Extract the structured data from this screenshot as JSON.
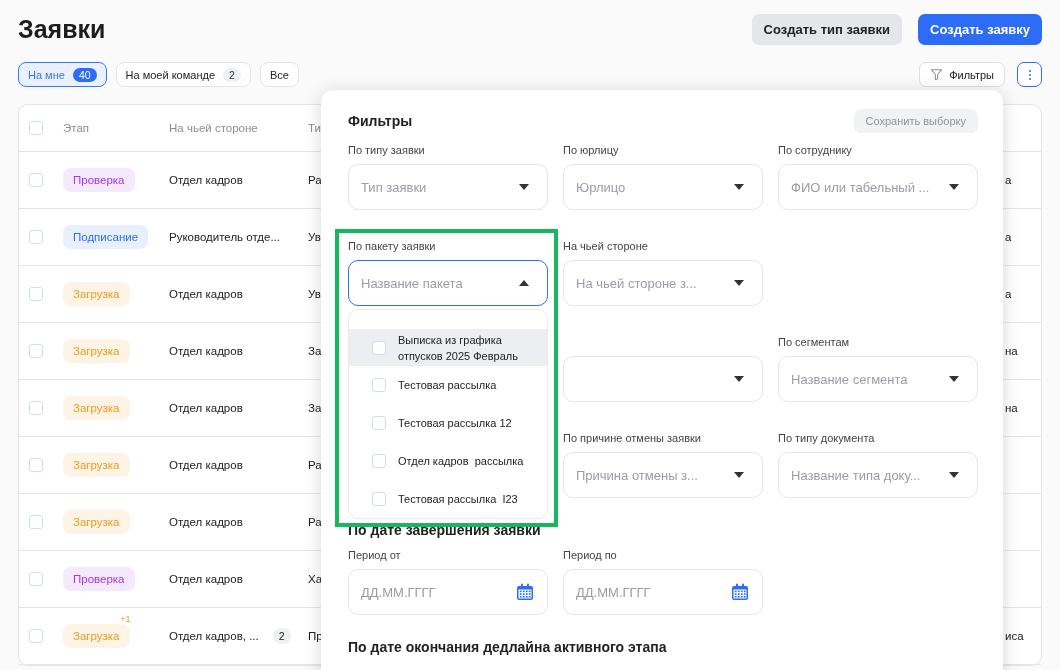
{
  "page": {
    "title": "Заявки"
  },
  "actions": [
    {
      "label": "Создать тип заявки",
      "kind": "secondary"
    },
    {
      "label": "Создать заявку",
      "kind": "primary"
    }
  ],
  "tabs": [
    {
      "label": "На мне",
      "count": "40",
      "selected": true
    },
    {
      "label": "На моей команде",
      "count": "2",
      "selected": false
    },
    {
      "label": "Все",
      "selected": false
    }
  ],
  "toolbar": {
    "filters_button": "Фильтры"
  },
  "table": {
    "columns": [
      "Этап",
      "На чьей стороне",
      "Ти"
    ],
    "header_checked": false,
    "rows": [
      {
        "checked": false,
        "stage": {
          "label": "Проверка",
          "color": "#a336f0"
        },
        "side": "Отдел кадров",
        "column_3": "Ра",
        "column_4": "а"
      },
      {
        "checked": false,
        "stage": {
          "label": "Подписание",
          "color": "#2d6cf5"
        },
        "side": "Руководитель отде...",
        "column_3": "Ув",
        "column_4": "а"
      },
      {
        "checked": false,
        "stage": {
          "label": "Загрузка",
          "color": "#f0991d"
        },
        "side": "Отдел кадров",
        "column_3": "Ув",
        "column_4": "а"
      },
      {
        "checked": false,
        "stage": {
          "label": "Загрузка",
          "color": "#f0991d"
        },
        "side": "Отдел кадров",
        "column_3": "За",
        "column_4": "на"
      },
      {
        "checked": false,
        "stage": {
          "label": "Загрузка",
          "color": "#f0991d"
        },
        "side": "Отдел кадров",
        "column_3": "За",
        "column_4": "на"
      },
      {
        "checked": false,
        "stage": {
          "label": "Загрузка",
          "color": "#f0991d"
        },
        "side": "Отдел кадров",
        "column_3": "Ра"
      },
      {
        "checked": false,
        "stage": {
          "label": "Загрузка",
          "color": "#f0991d"
        },
        "side": "Отдел кадров",
        "column_3": "Ра"
      },
      {
        "checked": false,
        "stage": {
          "label": "Проверка",
          "color": "#a336f0"
        },
        "side": "Отдел кадров",
        "column_3": "Ха"
      },
      {
        "checked": false,
        "stage": {
          "label": "Загрузка",
          "color": "#f0991d",
          "extra": "+1"
        },
        "side": "Отдел кадров, ...",
        "side_count": "2",
        "column_3": "Пр",
        "column_4": "иса"
      }
    ]
  },
  "filters_panel": {
    "title": "Фильтры",
    "save_button": "Сохранить выборку",
    "fields": [
      {
        "kind": "select",
        "label": "По типу заявки",
        "placeholder": "Тип заявки"
      },
      {
        "kind": "select",
        "label": "По юрлицу",
        "placeholder": "Юрлицо"
      },
      {
        "kind": "select",
        "label": "По сотруднику",
        "placeholder": "ФИО или табельный ..."
      },
      {
        "kind": "select",
        "label": "По пакету заявки",
        "placeholder": "Название пакета",
        "expanded": true,
        "highlighted": true,
        "options": [
          {
            "label": "Выписка из графика отпусков 2025 Февраль",
            "checked": false,
            "hovered": true
          },
          {
            "label": "Тестовая рассылка",
            "checked": false,
            "hovered": false
          },
          {
            "label": "Тестовая рассылка 12",
            "checked": false,
            "hovered": false
          },
          {
            "label": "Отдел кадров  рассылка",
            "checked": false,
            "hovered": false
          },
          {
            "label": "Тестовая рассылка  I23",
            "checked": false,
            "hovered": false
          }
        ]
      },
      {
        "kind": "select",
        "label": "На чьей стороне",
        "placeholder": "На чьей стороне з..."
      },
      {
        "kind": "blank"
      },
      {
        "kind": "blank"
      },
      {
        "kind": "select"
      },
      {
        "kind": "select",
        "label": "По сегментам",
        "placeholder": "Название сегмента"
      },
      {
        "kind": "blank"
      },
      {
        "kind": "select",
        "label": "По причине отмены заявки",
        "placeholder": "Причина отмены з..."
      },
      {
        "kind": "select",
        "label": "По типу документа",
        "placeholder": "Название типа доку..."
      }
    ],
    "sections": [
      {
        "title": "По дате завершения заявки",
        "fields": [
          {
            "kind": "date",
            "label": "Период от",
            "placeholder": "ДД.ММ.ГГГГ"
          },
          {
            "kind": "date",
            "label": "Период по",
            "placeholder": "ДД.ММ.ГГГГ"
          }
        ]
      },
      {
        "title": "По дате окончания дедлайна активного этапа"
      }
    ]
  }
}
